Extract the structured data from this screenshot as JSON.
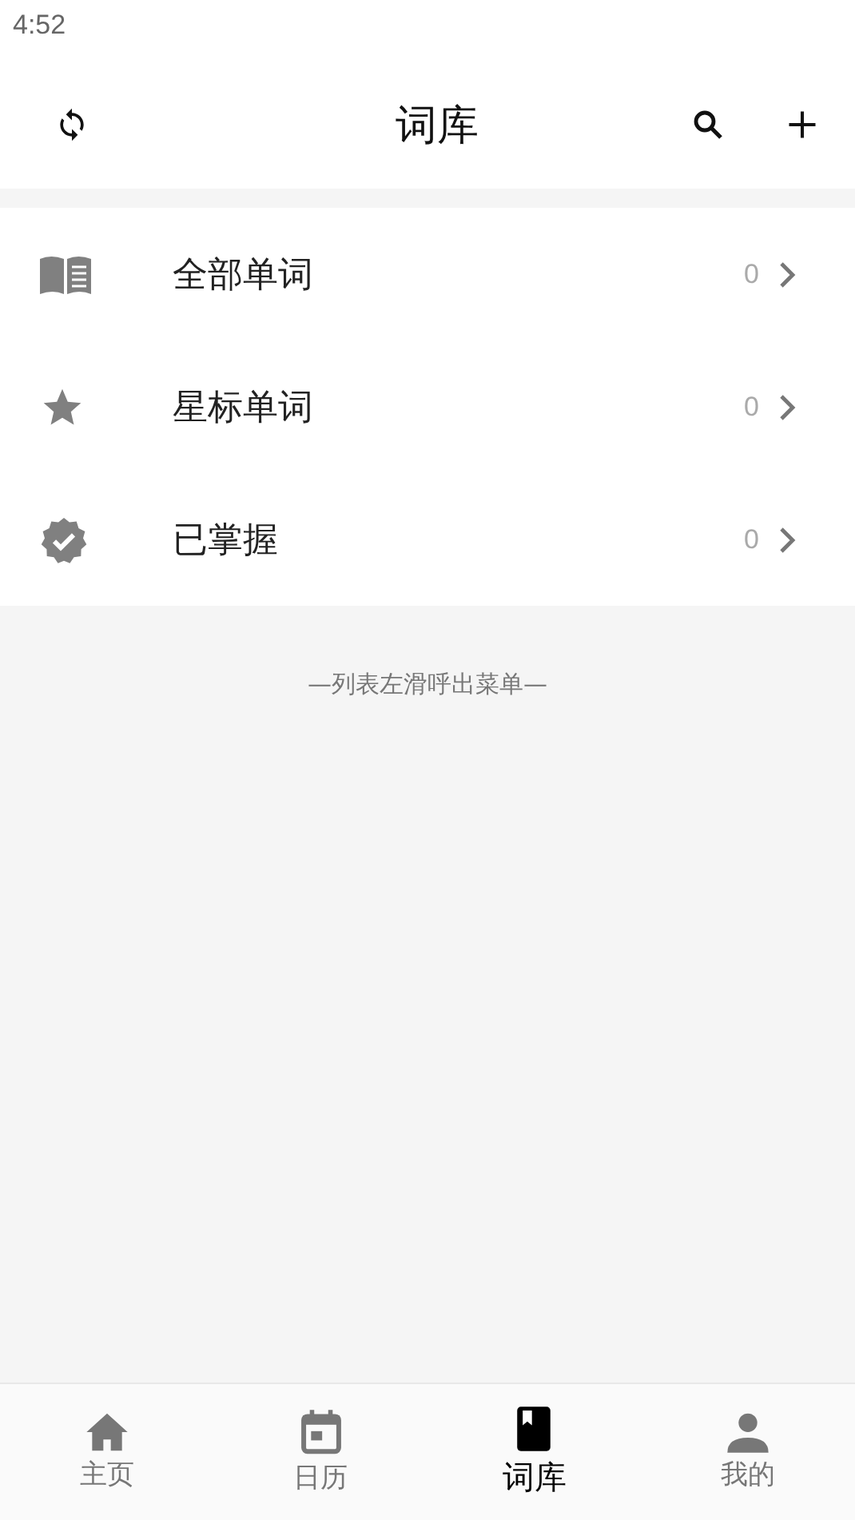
{
  "status_bar": {
    "time": "4:52"
  },
  "header": {
    "title": "词库"
  },
  "list": [
    {
      "kind": "book",
      "label": "全部单词",
      "count": "0"
    },
    {
      "kind": "star",
      "label": "星标单词",
      "count": "0"
    },
    {
      "kind": "verified",
      "label": "已掌握",
      "count": "0"
    }
  ],
  "hint": "—列表左滑呼出菜单—",
  "tabs": [
    {
      "kind": "home",
      "label": "主页",
      "selected": false
    },
    {
      "kind": "calendar",
      "label": "日历",
      "selected": false
    },
    {
      "kind": "book",
      "label": "词库",
      "selected": true
    },
    {
      "kind": "person",
      "label": "我的",
      "selected": false
    }
  ]
}
